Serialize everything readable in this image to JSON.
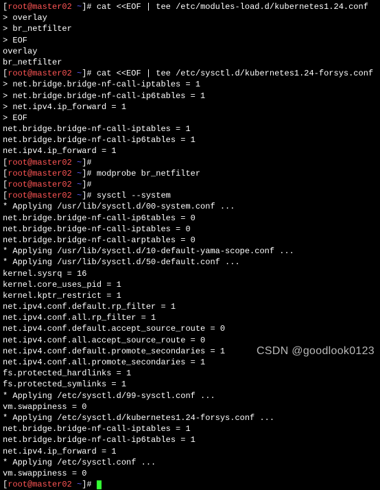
{
  "prompt": {
    "user_host": "root@master02",
    "path": "~",
    "sep": "[",
    "close": "]#"
  },
  "lines": [
    {
      "type": "cmd",
      "text": "cat <<EOF | tee /etc/modules-load.d/kubernetes1.24.conf"
    },
    {
      "type": "out",
      "text": "> overlay"
    },
    {
      "type": "out",
      "text": "> br_netfilter"
    },
    {
      "type": "out",
      "text": "> EOF"
    },
    {
      "type": "out",
      "text": "overlay"
    },
    {
      "type": "out",
      "text": "br_netfilter"
    },
    {
      "type": "cmd",
      "text": "cat <<EOF | tee /etc/sysctl.d/kubernetes1.24-forsys.conf"
    },
    {
      "type": "out",
      "text": "> net.bridge.bridge-nf-call-iptables = 1"
    },
    {
      "type": "out",
      "text": "> net.bridge.bridge-nf-call-ip6tables = 1"
    },
    {
      "type": "out",
      "text": "> net.ipv4.ip_forward = 1"
    },
    {
      "type": "out",
      "text": "> EOF"
    },
    {
      "type": "out",
      "text": "net.bridge.bridge-nf-call-iptables = 1"
    },
    {
      "type": "out",
      "text": "net.bridge.bridge-nf-call-ip6tables = 1"
    },
    {
      "type": "out",
      "text": "net.ipv4.ip_forward = 1"
    },
    {
      "type": "cmd",
      "text": ""
    },
    {
      "type": "cmd",
      "text": "modprobe br_netfilter"
    },
    {
      "type": "cmd",
      "text": ""
    },
    {
      "type": "cmd",
      "text": "sysctl --system"
    },
    {
      "type": "out",
      "text": "* Applying /usr/lib/sysctl.d/00-system.conf ..."
    },
    {
      "type": "out",
      "text": "net.bridge.bridge-nf-call-ip6tables = 0"
    },
    {
      "type": "out",
      "text": "net.bridge.bridge-nf-call-iptables = 0"
    },
    {
      "type": "out",
      "text": "net.bridge.bridge-nf-call-arptables = 0"
    },
    {
      "type": "out",
      "text": "* Applying /usr/lib/sysctl.d/10-default-yama-scope.conf ..."
    },
    {
      "type": "out",
      "text": "* Applying /usr/lib/sysctl.d/50-default.conf ..."
    },
    {
      "type": "out",
      "text": "kernel.sysrq = 16"
    },
    {
      "type": "out",
      "text": "kernel.core_uses_pid = 1"
    },
    {
      "type": "out",
      "text": "kernel.kptr_restrict = 1"
    },
    {
      "type": "out",
      "text": "net.ipv4.conf.default.rp_filter = 1"
    },
    {
      "type": "out",
      "text": "net.ipv4.conf.all.rp_filter = 1"
    },
    {
      "type": "out",
      "text": "net.ipv4.conf.default.accept_source_route = 0"
    },
    {
      "type": "out",
      "text": "net.ipv4.conf.all.accept_source_route = 0"
    },
    {
      "type": "out",
      "text": "net.ipv4.conf.default.promote_secondaries = 1"
    },
    {
      "type": "out",
      "text": "net.ipv4.conf.all.promote_secondaries = 1"
    },
    {
      "type": "out",
      "text": "fs.protected_hardlinks = 1"
    },
    {
      "type": "out",
      "text": "fs.protected_symlinks = 1"
    },
    {
      "type": "out",
      "text": "* Applying /etc/sysctl.d/99-sysctl.conf ..."
    },
    {
      "type": "out",
      "text": "vm.swappiness = 0"
    },
    {
      "type": "out",
      "text": "* Applying /etc/sysctl.d/kubernetes1.24-forsys.conf ..."
    },
    {
      "type": "out",
      "text": "net.bridge.bridge-nf-call-iptables = 1"
    },
    {
      "type": "out",
      "text": "net.bridge.bridge-nf-call-ip6tables = 1"
    },
    {
      "type": "out",
      "text": "net.ipv4.ip_forward = 1"
    },
    {
      "type": "out",
      "text": "* Applying /etc/sysctl.conf ..."
    },
    {
      "type": "out",
      "text": "vm.swappiness = 0"
    },
    {
      "type": "cmd",
      "text": "",
      "cursor": true
    }
  ],
  "watermark": "CSDN @goodlook0123"
}
